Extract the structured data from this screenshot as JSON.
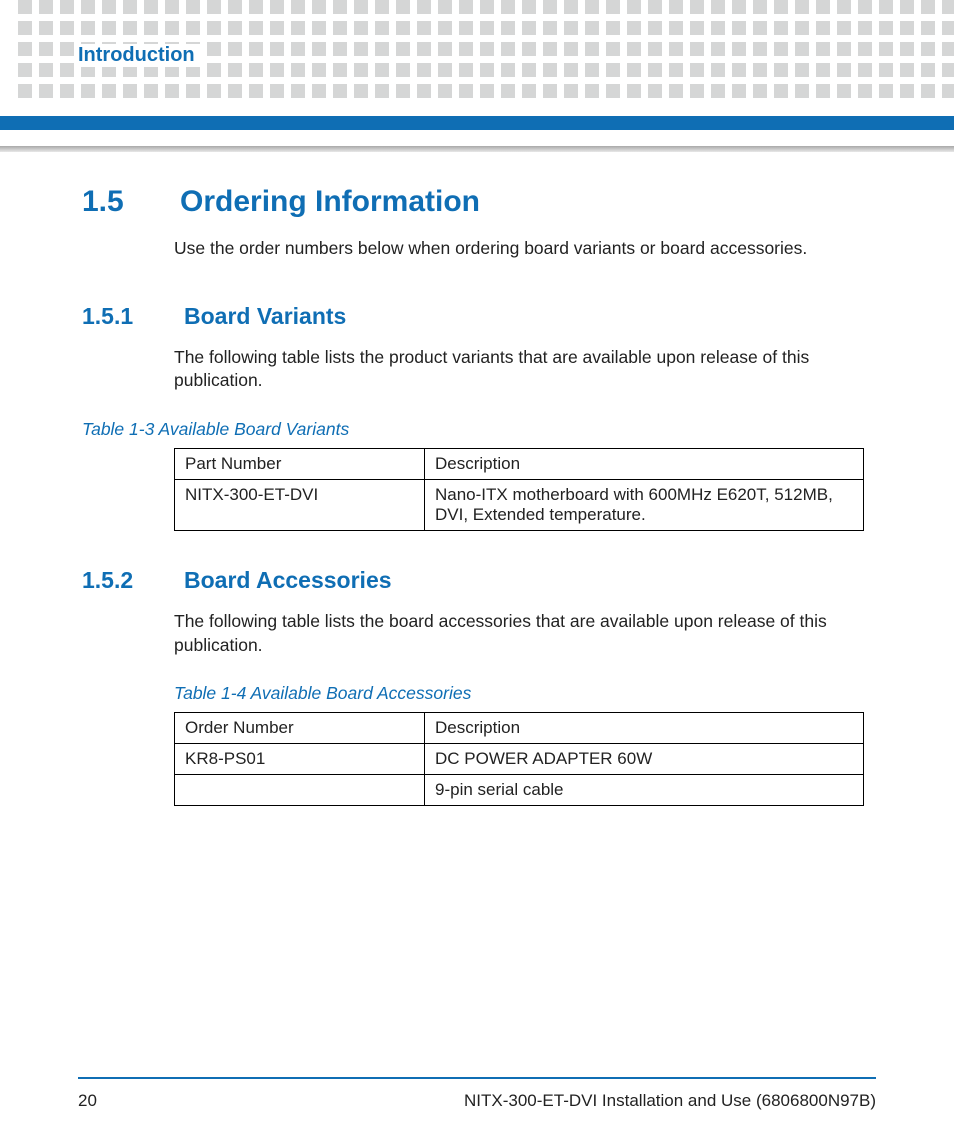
{
  "chapter": "Introduction",
  "section": {
    "num": "1.5",
    "title": "Ordering Information",
    "intro": "Use the order numbers below when ordering board variants or board accessories."
  },
  "sub1": {
    "num": "1.5.1",
    "title": "Board Variants",
    "body": " The following table lists the product  variants that are available upon release of this publication.",
    "table_caption": "Table 1-3 Available Board Variants",
    "headers": {
      "col1": "Part Number",
      "col2": "Description"
    },
    "rows": [
      {
        "col1": "NITX-300-ET-DVI",
        "col2": "Nano-ITX motherboard with 600MHz E620T, 512MB, DVI, Extended temperature."
      }
    ]
  },
  "sub2": {
    "num": "1.5.2",
    "title": "Board Accessories",
    "body": "The following table lists the board accessories that are available upon release of this publication.",
    "table_caption": "Table 1-4 Available Board Accessories",
    "headers": {
      "col1": "Order Number",
      "col2": "Description"
    },
    "rows": [
      {
        "col1": "KR8-PS01",
        "col2": "DC POWER ADAPTER 60W"
      },
      {
        "col1": "",
        "col2": "9-pin serial cable"
      }
    ]
  },
  "footer": {
    "page": "20",
    "doc": "NITX-300-ET-DVI Installation and Use (6806800N97B)"
  }
}
